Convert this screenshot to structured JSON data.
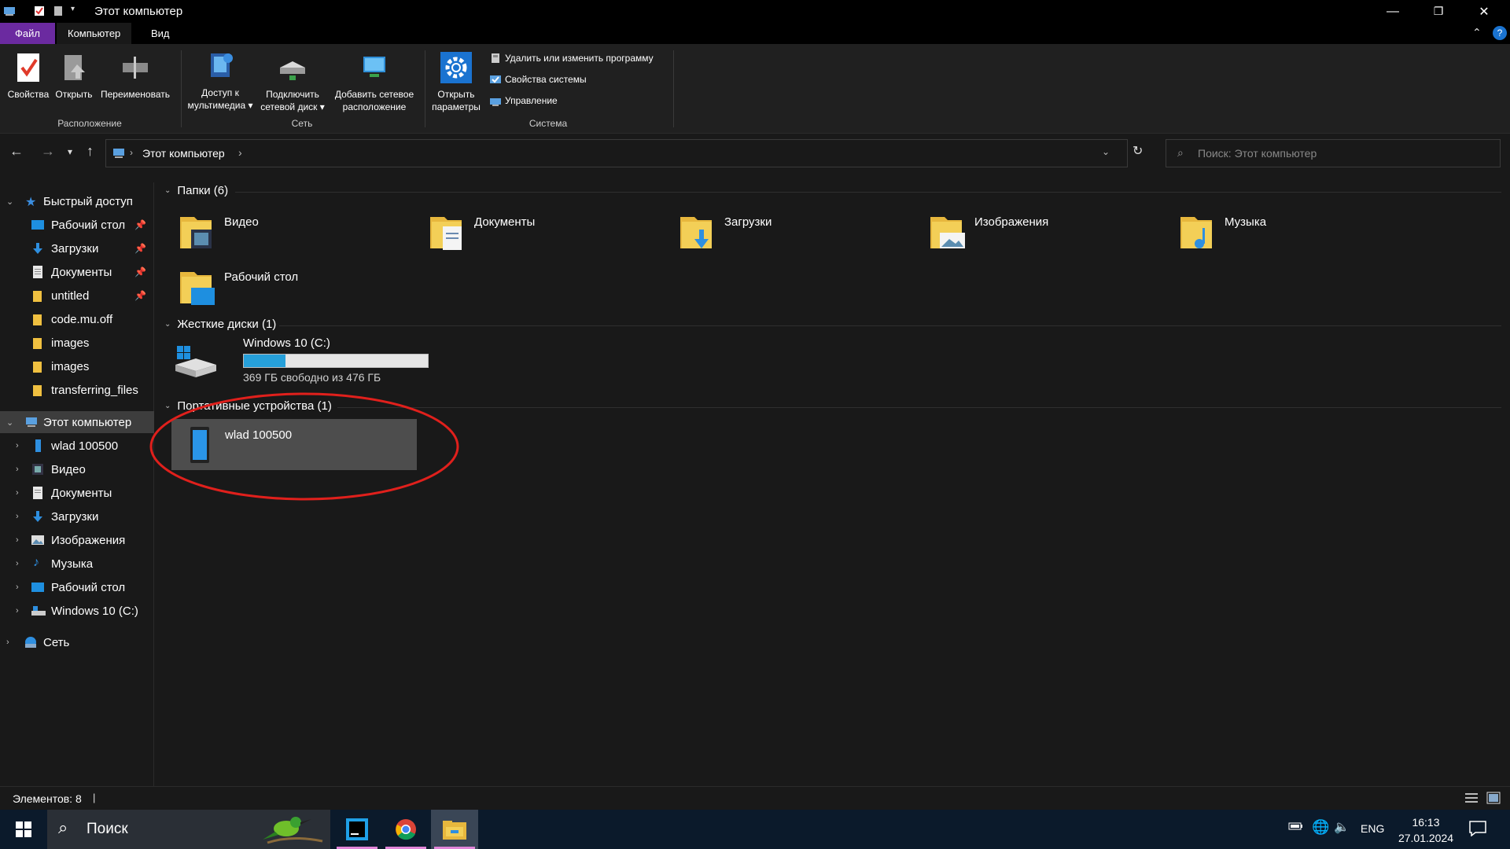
{
  "window": {
    "title": "Этот компьютер",
    "controls": {
      "minimize": "—",
      "restore": "❐",
      "close": "✕"
    }
  },
  "ribbon_tabs": [
    {
      "label": "Файл"
    },
    {
      "label": "Компьютер"
    },
    {
      "label": "Вид"
    }
  ],
  "ribbon": {
    "groups": {
      "location": "Расположение",
      "network": "Сеть",
      "system": "Система"
    },
    "buttons": {
      "properties": "Свойства",
      "open": "Открыть",
      "rename": "Переименовать",
      "media_access_1": "Доступ к",
      "media_access_2": "мультимедиа",
      "map_drive_1": "Подключить",
      "map_drive_2": "сетевой диск",
      "add_network_1": "Добавить сетевое",
      "add_network_2": "расположение",
      "open_settings_1": "Открыть",
      "open_settings_2": "параметры"
    },
    "system_items": {
      "uninstall": "Удалить или изменить программу",
      "system_properties": "Свойства системы",
      "manage": "Управление"
    }
  },
  "address": {
    "path": "Этот компьютер",
    "search_placeholder": "Поиск: Этот компьютер"
  },
  "sidebar": {
    "quick_access": "Быстрый доступ",
    "quick_items": [
      {
        "label": "Рабочий стол",
        "pinned": true
      },
      {
        "label": "Загрузки",
        "pinned": true
      },
      {
        "label": "Документы",
        "pinned": true
      },
      {
        "label": "untitled",
        "pinned": true
      },
      {
        "label": "code.mu.off",
        "pinned": false
      },
      {
        "label": "images",
        "pinned": false
      },
      {
        "label": "images",
        "pinned": false
      },
      {
        "label": "transferring_files",
        "pinned": false
      }
    ],
    "this_pc": "Этот компьютер",
    "pc_items": [
      {
        "label": "wlad 100500"
      },
      {
        "label": "Видео"
      },
      {
        "label": "Документы"
      },
      {
        "label": "Загрузки"
      },
      {
        "label": "Изображения"
      },
      {
        "label": "Музыка"
      },
      {
        "label": "Рабочий стол"
      },
      {
        "label": "Windows 10 (C:)"
      }
    ],
    "network": "Сеть"
  },
  "main": {
    "folders_header": "Папки (6)",
    "folders": [
      {
        "label": "Видео"
      },
      {
        "label": "Документы"
      },
      {
        "label": "Загрузки"
      },
      {
        "label": "Изображения"
      },
      {
        "label": "Музыка"
      },
      {
        "label": "Рабочий стол"
      }
    ],
    "drives_header": "Жесткие диски (1)",
    "drive": {
      "label": "Windows 10 (C:)",
      "free_text": "369 ГБ свободно из 476 ГБ",
      "used_fraction": 0.225
    },
    "portable_header": "Портативные устройства (1)",
    "portable_device": {
      "label": "wlad 100500"
    }
  },
  "status": {
    "items_count": "Элементов: 8"
  },
  "taskbar": {
    "search_label": "Поиск",
    "lang": "ENG",
    "time": "16:13",
    "date": "27.01.2024"
  },
  "colors": {
    "accent_file_tab": "#6b2aa0",
    "drive_bar_fill": "#26a0da",
    "annotation_ellipse": "#e0201c"
  }
}
